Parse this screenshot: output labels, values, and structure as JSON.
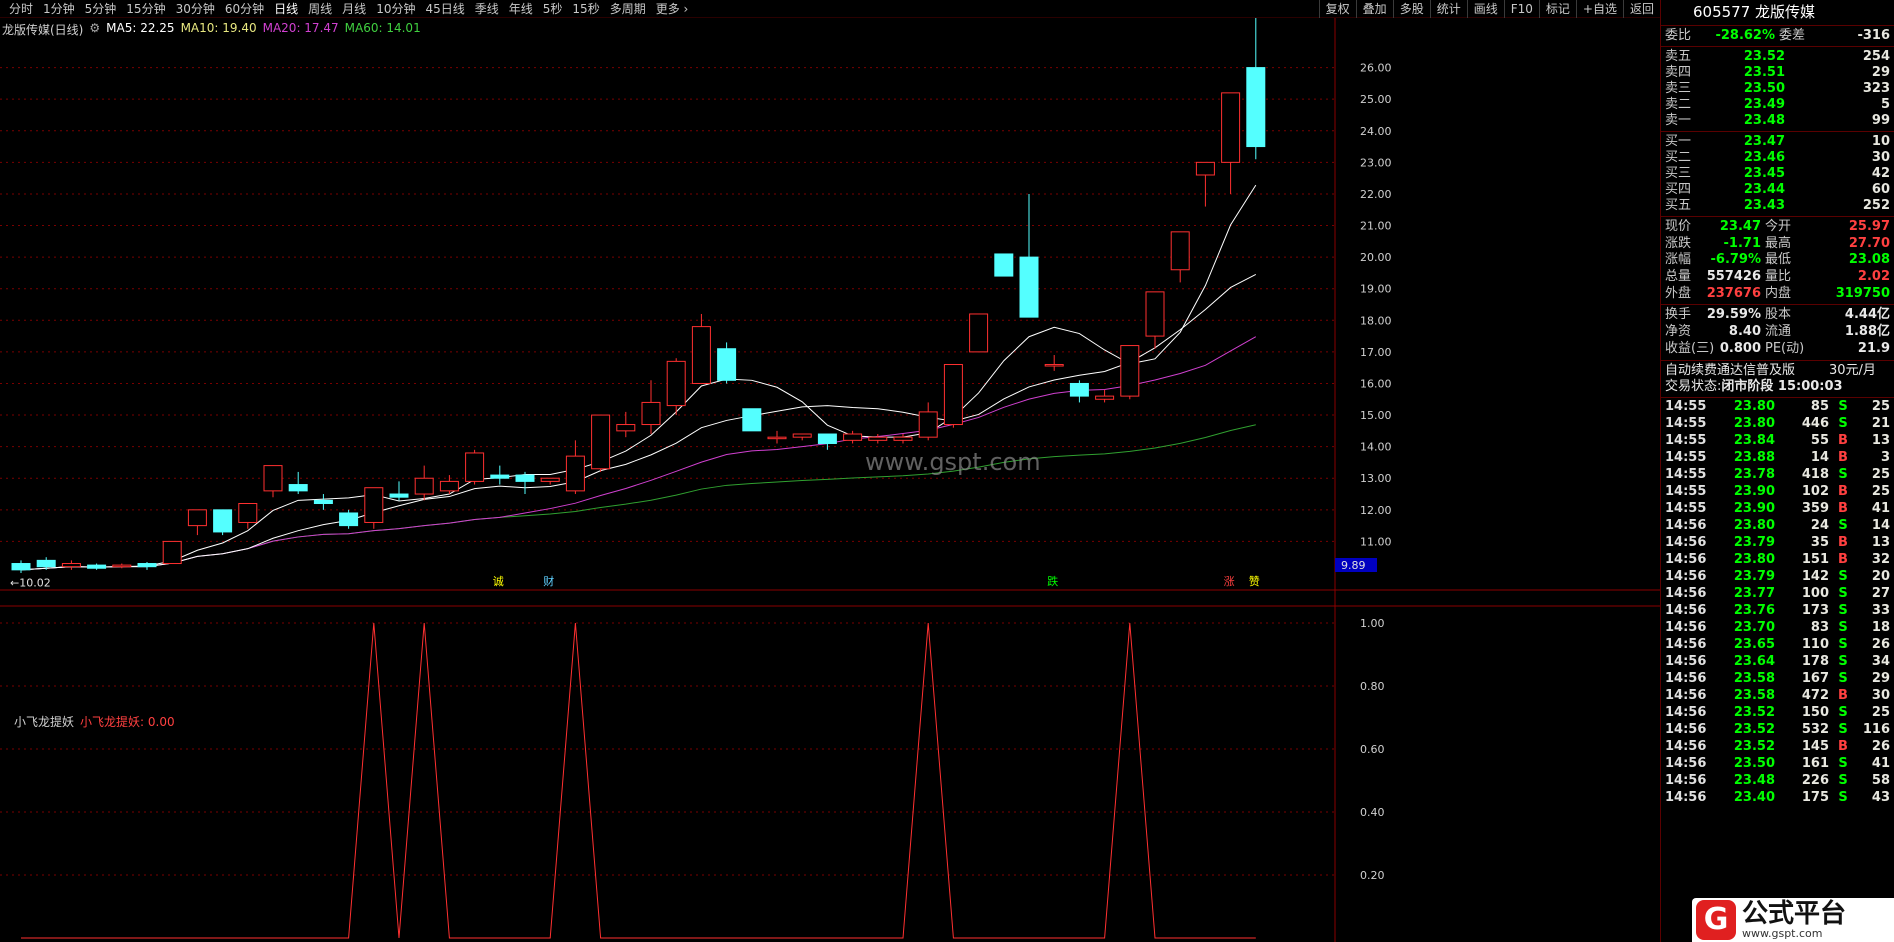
{
  "toolbar": {
    "periods": [
      "分时",
      "1分钟",
      "5分钟",
      "15分钟",
      "30分钟",
      "60分钟",
      "日线",
      "周线",
      "月线",
      "10分钟",
      "45日线",
      "季线",
      "年线",
      "5秒",
      "15秒",
      "多周期",
      "更多"
    ],
    "active_period": "日线",
    "tools": [
      "复权",
      "叠加",
      "多股",
      "统计",
      "画线",
      "F10",
      "标记",
      "+自选",
      "返回"
    ]
  },
  "legend": {
    "title": "龙版传媒(日线)",
    "ma5": "MA5: 22.25",
    "ma10": "MA10: 19.40",
    "ma20": "MA20: 17.47",
    "ma60": "MA60: 14.01"
  },
  "indicator": {
    "name": "小飞龙提妖",
    "value_label": "小飞龙提妖: 0.00"
  },
  "watermark": "www.gspt.com",
  "signals": [
    "诚",
    "财",
    "跌",
    "涨",
    "赞"
  ],
  "colors": {
    "up": "#ff3030",
    "down": "#54ffff",
    "ma5": "#ffffff",
    "ma10": "#ffffff",
    "ma20": "#d040d0",
    "ma60": "#30a030",
    "grid": "#7a0000"
  },
  "chart_data": {
    "type": "candlestick",
    "y_axis_ticks": [
      "26.00",
      "25.00",
      "24.00",
      "23.00",
      "22.00",
      "21.00",
      "20.00",
      "19.00",
      "18.00",
      "17.00",
      "16.00",
      "15.00",
      "14.00",
      "13.00",
      "12.00",
      "11.00"
    ],
    "y_axis_current": "9.89",
    "high_label": "27.70",
    "low_label": "10.02",
    "indicator_ticks": [
      "1.00",
      "0.80",
      "0.60",
      "0.40",
      "0.20"
    ],
    "candles": [
      {
        "o": 10.3,
        "c": 10.1,
        "h": 10.4,
        "l": 10.0
      },
      {
        "o": 10.4,
        "c": 10.2,
        "h": 10.5,
        "l": 10.1
      },
      {
        "o": 10.2,
        "c": 10.3,
        "h": 10.4,
        "l": 10.1
      },
      {
        "o": 10.25,
        "c": 10.15,
        "h": 10.3,
        "l": 10.1
      },
      {
        "o": 10.2,
        "c": 10.25,
        "h": 10.3,
        "l": 10.15
      },
      {
        "o": 10.3,
        "c": 10.2,
        "h": 10.35,
        "l": 10.1
      },
      {
        "o": 10.3,
        "c": 11.0,
        "h": 11.0,
        "l": 10.3
      },
      {
        "o": 11.5,
        "c": 12.0,
        "h": 12.0,
        "l": 11.2
      },
      {
        "o": 12.0,
        "c": 11.3,
        "h": 12.0,
        "l": 11.2
      },
      {
        "o": 11.6,
        "c": 12.2,
        "h": 12.2,
        "l": 11.4
      },
      {
        "o": 12.6,
        "c": 13.4,
        "h": 13.4,
        "l": 12.4
      },
      {
        "o": 12.8,
        "c": 12.6,
        "h": 13.2,
        "l": 12.5
      },
      {
        "o": 12.3,
        "c": 12.2,
        "h": 12.5,
        "l": 12.0
      },
      {
        "o": 11.9,
        "c": 11.5,
        "h": 12.0,
        "l": 11.4
      },
      {
        "o": 11.6,
        "c": 12.7,
        "h": 12.7,
        "l": 11.4
      },
      {
        "o": 12.5,
        "c": 12.4,
        "h": 12.9,
        "l": 12.3
      },
      {
        "o": 12.5,
        "c": 13.0,
        "h": 13.4,
        "l": 12.3
      },
      {
        "o": 12.6,
        "c": 12.9,
        "h": 13.1,
        "l": 12.5
      },
      {
        "o": 12.9,
        "c": 13.8,
        "h": 13.9,
        "l": 12.8
      },
      {
        "o": 13.1,
        "c": 13.0,
        "h": 13.4,
        "l": 12.8
      },
      {
        "o": 13.1,
        "c": 12.9,
        "h": 13.2,
        "l": 12.5
      },
      {
        "o": 12.9,
        "c": 13.0,
        "h": 13.0,
        "l": 12.8
      },
      {
        "o": 12.6,
        "c": 13.7,
        "h": 14.2,
        "l": 12.5
      },
      {
        "o": 13.3,
        "c": 15.0,
        "h": 15.0,
        "l": 13.2
      },
      {
        "o": 14.5,
        "c": 14.7,
        "h": 15.1,
        "l": 14.3
      },
      {
        "o": 14.7,
        "c": 15.4,
        "h": 16.1,
        "l": 14.4
      },
      {
        "o": 15.3,
        "c": 16.7,
        "h": 16.8,
        "l": 15.0
      },
      {
        "o": 16.0,
        "c": 17.8,
        "h": 18.2,
        "l": 16.0
      },
      {
        "o": 17.1,
        "c": 16.1,
        "h": 17.3,
        "l": 16.0
      },
      {
        "o": 15.2,
        "c": 14.5,
        "h": 15.2,
        "l": 14.5
      },
      {
        "o": 14.3,
        "c": 14.3,
        "h": 14.5,
        "l": 14.1
      },
      {
        "o": 14.3,
        "c": 14.4,
        "h": 14.4,
        "l": 14.2
      },
      {
        "o": 14.4,
        "c": 14.1,
        "h": 14.4,
        "l": 13.9
      },
      {
        "o": 14.2,
        "c": 14.4,
        "h": 14.5,
        "l": 14.1
      },
      {
        "o": 14.2,
        "c": 14.3,
        "h": 14.4,
        "l": 14.1
      },
      {
        "o": 14.2,
        "c": 14.3,
        "h": 14.4,
        "l": 14.1
      },
      {
        "o": 14.3,
        "c": 15.1,
        "h": 15.4,
        "l": 14.2
      },
      {
        "o": 14.7,
        "c": 16.6,
        "h": 16.6,
        "l": 14.6
      },
      {
        "o": 17.0,
        "c": 18.2,
        "h": 18.2,
        "l": 17.0
      },
      {
        "o": 20.1,
        "c": 19.4,
        "h": 20.1,
        "l": 19.4
      },
      {
        "o": 20.0,
        "c": 18.1,
        "h": 22.0,
        "l": 18.1
      },
      {
        "o": 16.6,
        "c": 16.6,
        "h": 16.9,
        "l": 16.4
      },
      {
        "o": 16.0,
        "c": 15.6,
        "h": 16.1,
        "l": 15.4
      },
      {
        "o": 15.5,
        "c": 15.6,
        "h": 15.8,
        "l": 15.4
      },
      {
        "o": 15.6,
        "c": 17.2,
        "h": 17.2,
        "l": 15.5
      },
      {
        "o": 17.5,
        "c": 18.9,
        "h": 18.9,
        "l": 17.1
      },
      {
        "o": 19.6,
        "c": 20.8,
        "h": 20.8,
        "l": 19.2
      },
      {
        "o": 22.6,
        "c": 23.0,
        "h": 23.0,
        "l": 21.6
      },
      {
        "o": 23.0,
        "c": 25.2,
        "h": 25.2,
        "l": 22.0
      },
      {
        "o": 26.0,
        "c": 23.5,
        "h": 27.7,
        "l": 23.1
      }
    ],
    "indicator_peaks": [
      14,
      16,
      22,
      36,
      44
    ],
    "quote": {
      "symbol_title": "605577 龙版传媒",
      "weibi_label": "委比",
      "weibi": "-28.62%",
      "weicha_label": "委差",
      "weicha": "-316",
      "asks": [
        {
          "label": "卖五",
          "price": "23.52",
          "vol": "254"
        },
        {
          "label": "卖四",
          "price": "23.51",
          "vol": "29"
        },
        {
          "label": "卖三",
          "price": "23.50",
          "vol": "323"
        },
        {
          "label": "卖二",
          "price": "23.49",
          "vol": "5"
        },
        {
          "label": "卖一",
          "price": "23.48",
          "vol": "99"
        }
      ],
      "bids": [
        {
          "label": "买一",
          "price": "23.47",
          "vol": "10"
        },
        {
          "label": "买二",
          "price": "23.46",
          "vol": "30"
        },
        {
          "label": "买三",
          "price": "23.45",
          "vol": "42"
        },
        {
          "label": "买四",
          "price": "23.44",
          "vol": "60"
        },
        {
          "label": "买五",
          "price": "23.43",
          "vol": "252"
        }
      ],
      "stats1": [
        {
          "l1": "现价",
          "v1": "23.47",
          "c1": "green",
          "l2": "今开",
          "v2": "25.97",
          "c2": "red"
        },
        {
          "l1": "涨跌",
          "v1": "-1.71",
          "c1": "green",
          "l2": "最高",
          "v2": "27.70",
          "c2": "red"
        },
        {
          "l1": "涨幅",
          "v1": "-6.79%",
          "c1": "green",
          "l2": "最低",
          "v2": "23.08",
          "c2": "green"
        },
        {
          "l1": "总量",
          "v1": "557426",
          "c1": "white",
          "l2": "量比",
          "v2": "2.02",
          "c2": "red"
        },
        {
          "l1": "外盘",
          "v1": "237676",
          "c1": "red",
          "l2": "内盘",
          "v2": "319750",
          "c2": "green"
        }
      ],
      "stats2": [
        {
          "l1": "换手",
          "v1": "29.59%",
          "c1": "white",
          "l2": "股本",
          "v2": "4.44亿",
          "c2": "white"
        },
        {
          "l1": "净资",
          "v1": "8.40",
          "c1": "white",
          "l2": "流通",
          "v2": "1.88亿",
          "c2": "white"
        },
        {
          "l1": "收益(三)",
          "v1": "0.800",
          "c1": "white",
          "l2": "PE(动)",
          "v2": "21.9",
          "c2": "white"
        }
      ],
      "ad_line": "自动续费通达信普及版",
      "ad_price": "30元/月",
      "trade_status_label": "交易状态:",
      "trade_status": "闭市阶段 15:00:03"
    },
    "ticks": [
      {
        "t": "14:55",
        "p": "23.80",
        "pc": "green",
        "q": "85",
        "qc": "white",
        "d": "S",
        "n": "25"
      },
      {
        "t": "14:55",
        "p": "23.80",
        "pc": "green",
        "q": "446",
        "qc": "white",
        "d": "S",
        "n": "21"
      },
      {
        "t": "14:55",
        "p": "23.84",
        "pc": "green",
        "q": "55",
        "qc": "white",
        "d": "B",
        "n": "13"
      },
      {
        "t": "14:55",
        "p": "23.88",
        "pc": "green",
        "q": "14",
        "qc": "white",
        "d": "B",
        "n": "3"
      },
      {
        "t": "14:55",
        "p": "23.78",
        "pc": "green",
        "q": "418",
        "qc": "white",
        "d": "S",
        "n": "25"
      },
      {
        "t": "14:55",
        "p": "23.90",
        "pc": "green",
        "q": "102",
        "qc": "white",
        "d": "B",
        "n": "25"
      },
      {
        "t": "14:55",
        "p": "23.90",
        "pc": "green",
        "q": "359",
        "qc": "white",
        "d": "B",
        "n": "41"
      },
      {
        "t": "14:56",
        "p": "23.80",
        "pc": "green",
        "q": "24",
        "qc": "white",
        "d": "S",
        "n": "14"
      },
      {
        "t": "14:56",
        "p": "23.79",
        "pc": "green",
        "q": "35",
        "qc": "white",
        "d": "B",
        "n": "13"
      },
      {
        "t": "14:56",
        "p": "23.80",
        "pc": "green",
        "q": "151",
        "qc": "white",
        "d": "B",
        "n": "32"
      },
      {
        "t": "14:56",
        "p": "23.79",
        "pc": "green",
        "q": "142",
        "qc": "white",
        "d": "S",
        "n": "20"
      },
      {
        "t": "14:56",
        "p": "23.77",
        "pc": "green",
        "q": "100",
        "qc": "white",
        "d": "S",
        "n": "27"
      },
      {
        "t": "14:56",
        "p": "23.76",
        "pc": "green",
        "q": "173",
        "qc": "white",
        "d": "S",
        "n": "33"
      },
      {
        "t": "14:56",
        "p": "23.70",
        "pc": "green",
        "q": "83",
        "qc": "white",
        "d": "S",
        "n": "18"
      },
      {
        "t": "14:56",
        "p": "23.65",
        "pc": "green",
        "q": "110",
        "qc": "white",
        "d": "S",
        "n": "26"
      },
      {
        "t": "14:56",
        "p": "23.64",
        "pc": "green",
        "q": "178",
        "qc": "white",
        "d": "S",
        "n": "34"
      },
      {
        "t": "14:56",
        "p": "23.58",
        "pc": "green",
        "q": "167",
        "qc": "white",
        "d": "S",
        "n": "29"
      },
      {
        "t": "14:56",
        "p": "23.58",
        "pc": "green",
        "q": "472",
        "qc": "white",
        "d": "B",
        "n": "30"
      },
      {
        "t": "14:56",
        "p": "23.52",
        "pc": "green",
        "q": "150",
        "qc": "white",
        "d": "S",
        "n": "25"
      },
      {
        "t": "14:56",
        "p": "23.52",
        "pc": "green",
        "q": "532",
        "qc": "purple",
        "d": "S",
        "n": "116"
      },
      {
        "t": "14:56",
        "p": "23.52",
        "pc": "green",
        "q": "145",
        "qc": "white",
        "d": "B",
        "n": "26"
      },
      {
        "t": "14:56",
        "p": "23.50",
        "pc": "green",
        "q": "161",
        "qc": "white",
        "d": "S",
        "n": "41"
      },
      {
        "t": "14:56",
        "p": "23.48",
        "pc": "green",
        "q": "226",
        "qc": "white",
        "d": "S",
        "n": "58"
      },
      {
        "t": "14:56",
        "p": "23.40",
        "pc": "green",
        "q": "175",
        "qc": "white",
        "d": "S",
        "n": "43"
      }
    ]
  },
  "logo": {
    "title": "公式平台",
    "url": "www.gspt.com"
  }
}
